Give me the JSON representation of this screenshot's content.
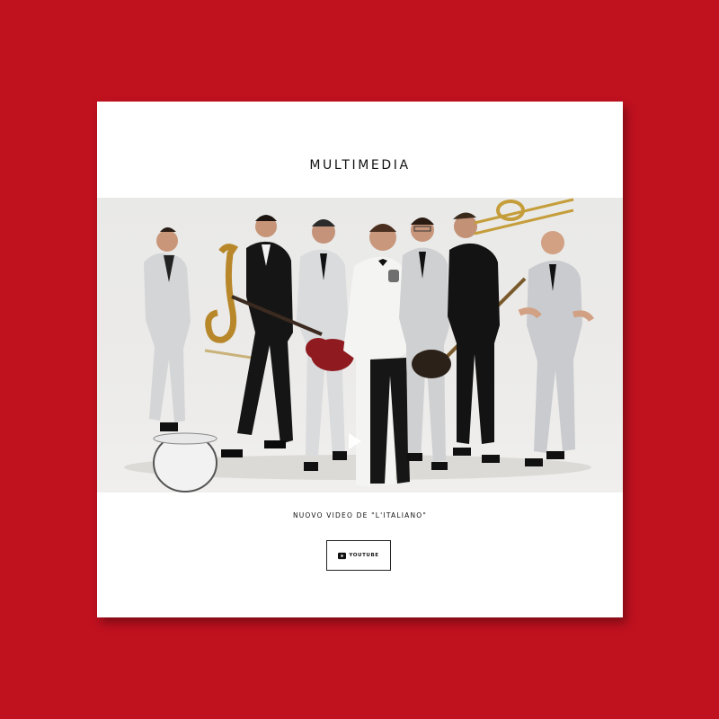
{
  "colors": {
    "background": "#c0111f",
    "card": "#ffffff",
    "text": "#111111"
  },
  "section": {
    "title": "MULTIMEDIA"
  },
  "video": {
    "caption": "NUOVO VIDEO DE \"L'ITALIANO\"",
    "play_icon": "play-icon"
  },
  "youtube_button": {
    "icon": "youtube-icon",
    "label": "YOUTUBE"
  }
}
